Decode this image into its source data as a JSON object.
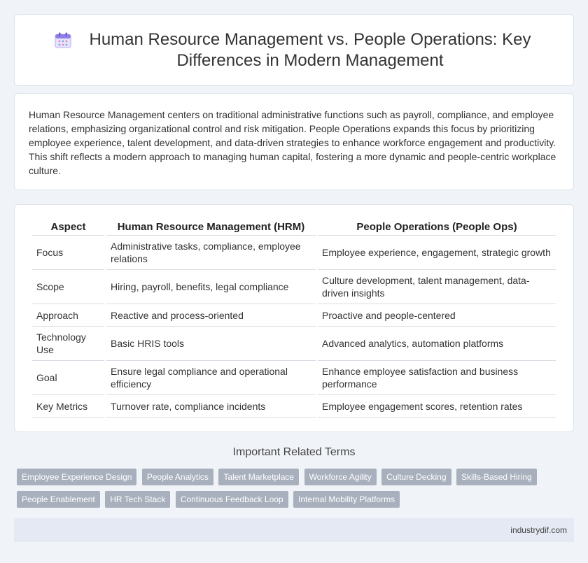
{
  "header": {
    "icon": "calendar-icon",
    "title": "Human Resource Management vs. People Operations: Key Differences in Modern Management"
  },
  "intro": {
    "text": "Human Resource Management centers on traditional administrative functions such as payroll, compliance, and employee relations, emphasizing organizational control and risk mitigation. People Operations expands this focus by prioritizing employee experience, talent development, and data-driven strategies to enhance workforce engagement and productivity. This shift reflects a modern approach to managing human capital, fostering a more dynamic and people-centric workplace culture."
  },
  "table": {
    "headers": [
      "Aspect",
      "Human Resource Management (HRM)",
      "People Operations (People Ops)"
    ],
    "rows": [
      [
        "Focus",
        "Administrative tasks, compliance, employee relations",
        "Employee experience, engagement, strategic growth"
      ],
      [
        "Scope",
        "Hiring, payroll, benefits, legal compliance",
        "Culture development, talent management, data-driven insights"
      ],
      [
        "Approach",
        "Reactive and process-oriented",
        "Proactive and people-centered"
      ],
      [
        "Technology Use",
        "Basic HRIS tools",
        "Advanced analytics, automation platforms"
      ],
      [
        "Goal",
        "Ensure legal compliance and operational efficiency",
        "Enhance employee satisfaction and business performance"
      ],
      [
        "Key Metrics",
        "Turnover rate, compliance incidents",
        "Employee engagement scores, retention rates"
      ]
    ]
  },
  "related": {
    "title": "Important Related Terms",
    "tags": [
      "Employee Experience Design",
      "People Analytics",
      "Talent Marketplace",
      "Workforce Agility",
      "Culture Decking",
      "Skills-Based Hiring",
      "People Enablement",
      "HR Tech Stack",
      "Continuous Feedback Loop",
      "Internal Mobility Platforms"
    ]
  },
  "footer": {
    "site": "industrydif.com"
  },
  "colors": {
    "background": "#f0f3f8",
    "tag": "#a9b0bd",
    "footer": "#e4e9f3"
  }
}
